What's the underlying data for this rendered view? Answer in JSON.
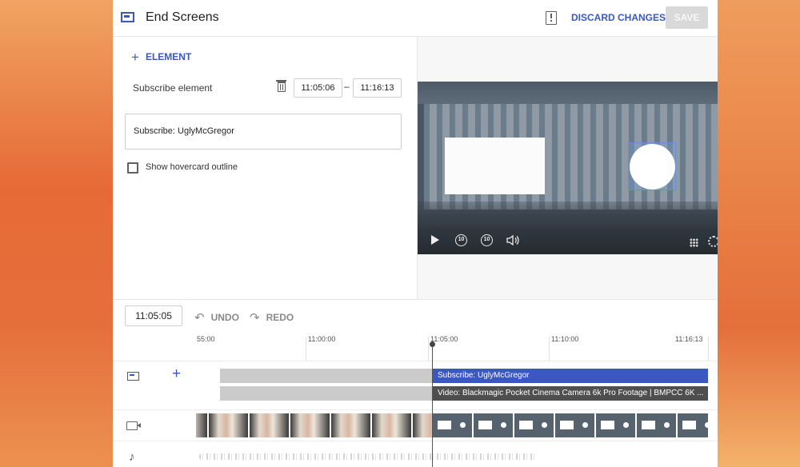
{
  "header": {
    "title": "End Screens",
    "discard_label": "DISCARD CHANGES",
    "save_label": "SAVE"
  },
  "editor": {
    "add_element_label": "ELEMENT",
    "element_label": "Subscribe element",
    "start_time": "11:05:06",
    "end_time": "11:16:13",
    "dash": "–",
    "field_value": "Subscribe: UglyMcGregor",
    "hovercard_label": "Show hovercard outline",
    "hovercard_checked": false
  },
  "player": {
    "replay_label": "10",
    "forward_label": "10"
  },
  "timeline": {
    "current_time": "11:05:05",
    "undo_label": "UNDO",
    "redo_label": "REDO",
    "ticks": [
      "55:00",
      "11:00:00",
      "11:05:00",
      "11:10:00",
      "11:16:13"
    ],
    "subscribe_bar": "Subscribe: UglyMcGregor",
    "video_bar": "Video: Blackmagic Pocket Cinema Camera 6k Pro Footage | BMPCC 6K ..."
  },
  "colors": {
    "accent": "#3b57c4",
    "video_bar": "#4f4f4f",
    "disabled_button": "#d9d9d9"
  },
  "icons": [
    "end-screen-icon",
    "feedback-icon",
    "plus-icon",
    "trash-icon",
    "play-icon",
    "replay-10-icon",
    "forward-10-icon",
    "volume-icon",
    "grid-icon",
    "gear-icon",
    "undo-icon",
    "redo-icon",
    "video-camera-icon",
    "music-note-icon"
  ]
}
